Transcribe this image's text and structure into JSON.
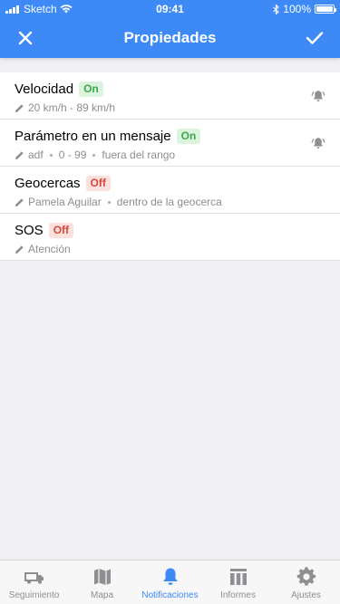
{
  "status_bar": {
    "carrier": "Sketch",
    "time": "09:41",
    "battery": "100%",
    "battery_level": 1.0
  },
  "header": {
    "title": "Propiedades",
    "close_icon": "close-icon",
    "confirm_icon": "checkmark-icon"
  },
  "items": [
    {
      "title": "Velocidad",
      "status": "On",
      "details": [
        "20 km/h - 89 km/h"
      ],
      "bell": true
    },
    {
      "title": "Parámetro en un mensaje",
      "status": "On",
      "details": [
        "adf",
        "0 - 99",
        "fuera del rango"
      ],
      "bell": true
    },
    {
      "title": "Geocercas",
      "status": "Off",
      "details": [
        "Pamela Aguilar",
        "dentro de la geocerca"
      ],
      "bell": false
    },
    {
      "title": "SOS",
      "status": "Off",
      "details": [
        "Atención"
      ],
      "bell": false
    }
  ],
  "tabbar": {
    "tabs": [
      {
        "label": "Seguimiento",
        "icon": "truck-icon",
        "active": false
      },
      {
        "label": "Mapa",
        "icon": "map-icon",
        "active": false
      },
      {
        "label": "Notificaciones",
        "icon": "bell-icon",
        "active": true
      },
      {
        "label": "Informes",
        "icon": "reports-icon",
        "active": false
      },
      {
        "label": "Ajustes",
        "icon": "gear-icon",
        "active": false
      }
    ]
  },
  "colors": {
    "accent": "#3d8af7",
    "on_text": "#3aa94a",
    "on_bg": "#dcf3de",
    "off_text": "#d9483b",
    "off_bg": "#fbe1de"
  }
}
